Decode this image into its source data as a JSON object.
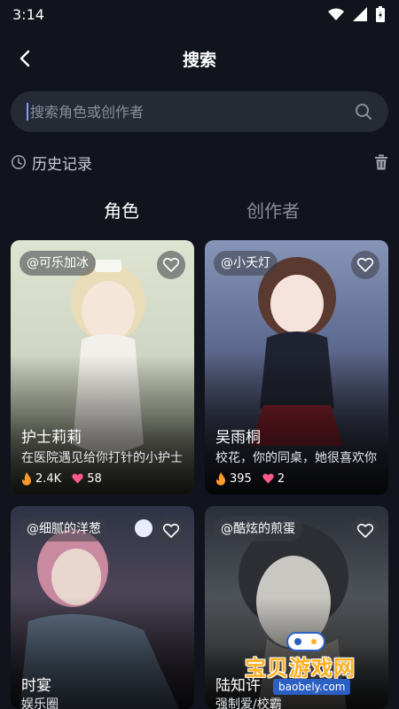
{
  "status_bar": {
    "time": "3:14"
  },
  "header": {
    "title": "搜索"
  },
  "search": {
    "placeholder": "搜索角色或创作者",
    "value": ""
  },
  "history": {
    "title": "历史记录"
  },
  "tabs": [
    {
      "label": "角色",
      "active": true
    },
    {
      "label": "创作者",
      "active": false
    }
  ],
  "cards": [
    {
      "creator": "@可乐加冰",
      "name": "护士莉莉",
      "desc": "在医院遇见给你打针的小护士",
      "fire": "2.4K",
      "likes": "58"
    },
    {
      "creator": "@小夭灯",
      "name": "吴雨桐",
      "desc": "校花，你的同桌，她很喜欢你",
      "fire": "395",
      "likes": "2"
    },
    {
      "creator": "@细腻的洋葱",
      "name": "时宴",
      "desc": "娱乐圈"
    },
    {
      "creator": "@酷炫的煎蛋",
      "name": "陆知许",
      "desc": "强制爱/校霸"
    }
  ],
  "watermark": {
    "text": "宝贝游戏网",
    "url": "baobely.com"
  },
  "colors": {
    "background": "#11141c",
    "search_bg": "#262a35",
    "fire": "#ff9a2b",
    "heart": "#ff5a8a",
    "watermark": "#ffb01f"
  }
}
